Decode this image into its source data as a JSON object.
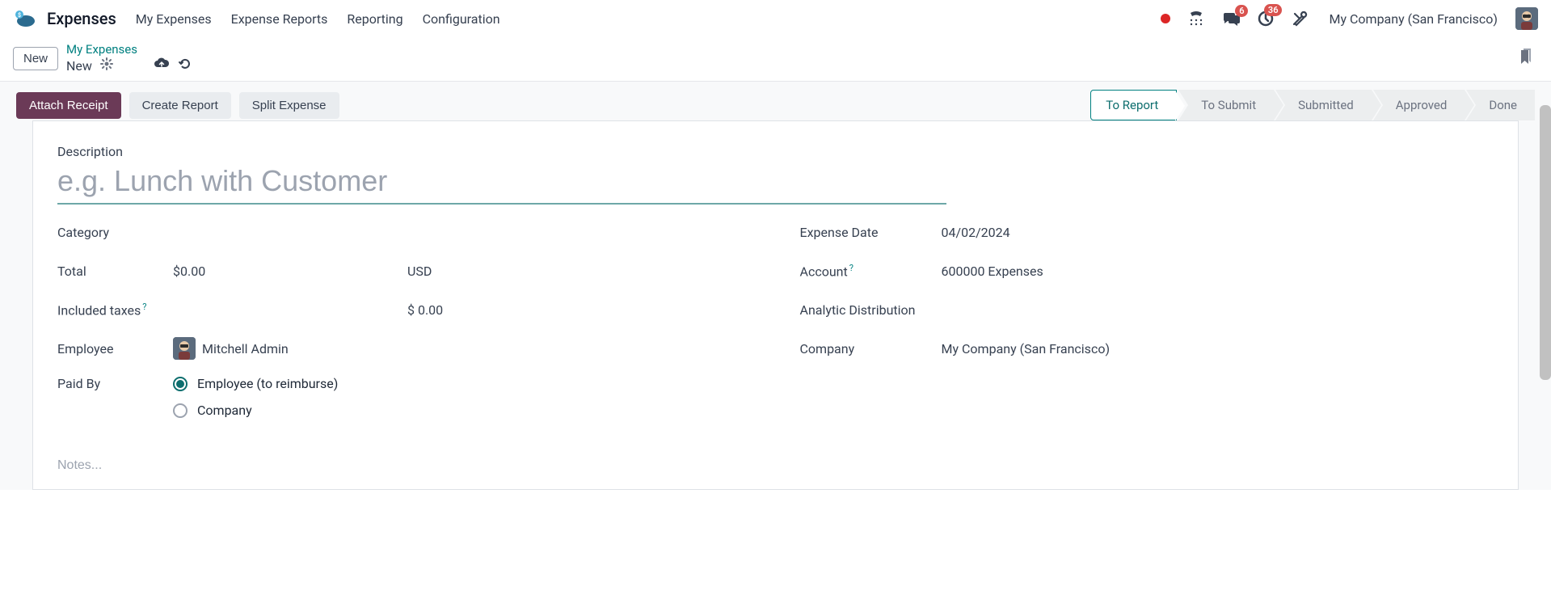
{
  "nav": {
    "app_title": "Expenses",
    "links": [
      "My Expenses",
      "Expense Reports",
      "Reporting",
      "Configuration"
    ],
    "chat_badge": "6",
    "activity_badge": "36",
    "company": "My Company (San Francisco)"
  },
  "breadcrumb": {
    "new_button": "New",
    "parent": "My Expenses",
    "current": "New"
  },
  "actions": {
    "attach": "Attach Receipt",
    "create_report": "Create Report",
    "split": "Split Expense"
  },
  "status_steps": [
    "To Report",
    "To Submit",
    "Submitted",
    "Approved",
    "Done"
  ],
  "form": {
    "description_label": "Description",
    "description_placeholder": "e.g. Lunch with Customer",
    "category_label": "Category",
    "category_value": "",
    "total_label": "Total",
    "total_value": "$0.00",
    "currency": "USD",
    "included_taxes_label": "Included taxes",
    "tax_amount": "$ 0.00",
    "employee_label": "Employee",
    "employee_name": "Mitchell Admin",
    "paid_by_label": "Paid By",
    "paid_by_options": {
      "employee": "Employee (to reimburse)",
      "company": "Company"
    },
    "expense_date_label": "Expense Date",
    "expense_date_value": "04/02/2024",
    "account_label": "Account",
    "account_value": "600000 Expenses",
    "analytic_label": "Analytic Distribution",
    "analytic_value": "",
    "company_label": "Company",
    "company_value": "My Company (San Francisco)",
    "notes_placeholder": "Notes..."
  }
}
